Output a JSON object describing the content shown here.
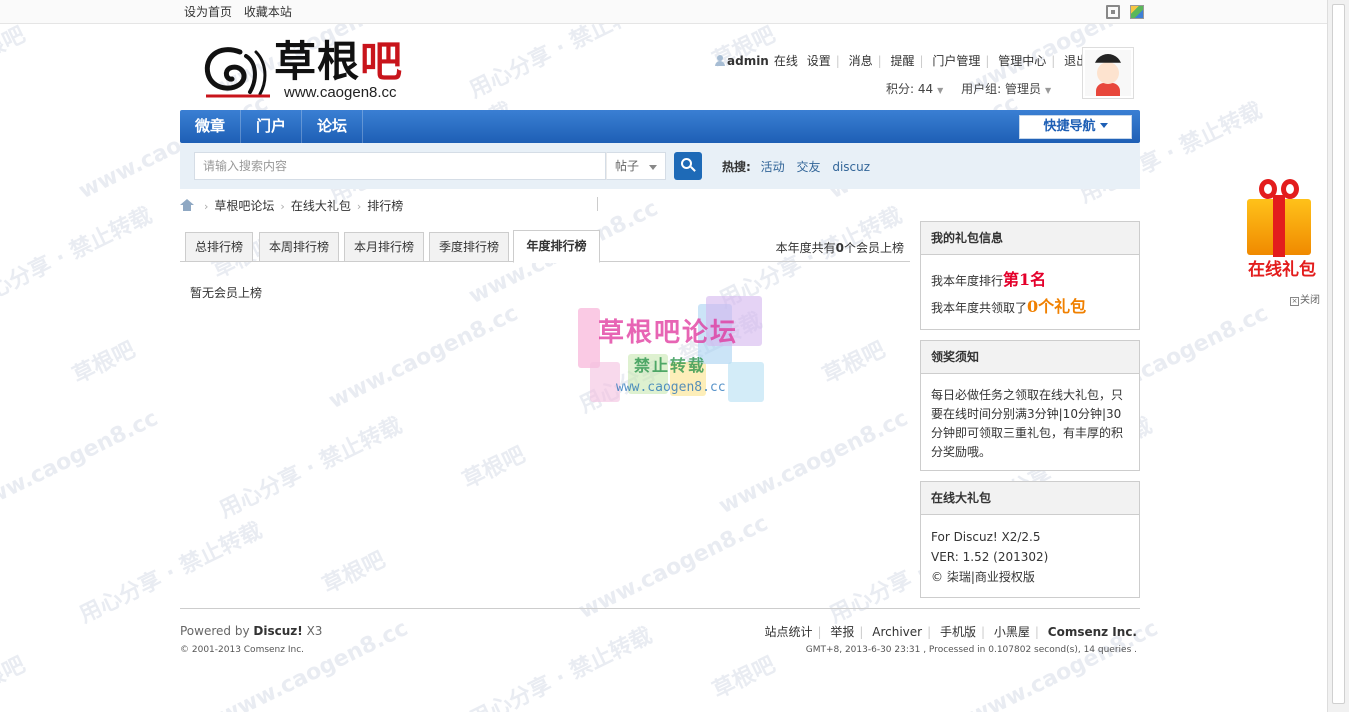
{
  "topbar": {
    "links": [
      "设为首页",
      "收藏本站"
    ]
  },
  "logo": {
    "title_black": "草根",
    "title_red": "吧",
    "url": "www.caogen8.cc"
  },
  "user": {
    "name": "admin",
    "status": "在线",
    "links": [
      "设置",
      "消息",
      "提醒",
      "门户管理",
      "管理中心",
      "退出"
    ],
    "points": "积分: 44",
    "group": "用户组: 管理员"
  },
  "nav": {
    "items": [
      "微章",
      "门户",
      "论坛"
    ],
    "quick_label": "快捷导航"
  },
  "search": {
    "placeholder": "请输入搜索内容",
    "type": "帖子",
    "hot_label": "热搜:",
    "hot_keywords": [
      "活动",
      "交友",
      "discuz"
    ]
  },
  "breadcrumb": [
    "草根吧论坛",
    "在线大礼包",
    "排行榜"
  ],
  "tabs": {
    "items": [
      "总排行榜",
      "本周排行榜",
      "本月排行榜",
      "季度排行榜",
      "年度排行榜"
    ],
    "active_index": 4,
    "count_prefix": "本年度共有",
    "count_value": "0",
    "count_suffix": "个会员上榜"
  },
  "empty_text": "暂无会员上榜",
  "sidebar": {
    "my_gift": {
      "title": "我的礼包信息",
      "rank_prefix": "我本年度排行",
      "rank_value": "第1名",
      "count_prefix": "我本年度共领取了",
      "count_value": "0个礼包"
    },
    "notice": {
      "title": "领奖须知",
      "body": "每日必做任务之领取在线大礼包，只要在线时间分别满3分钟|10分钟|30分钟即可领取三重礼包，有丰厚的积分奖励哦。"
    },
    "plugin": {
      "title": "在线大礼包",
      "lines": [
        "For Discuz! X2/2.5",
        "VER: 1.52 (201302)",
        "© 柒瑞|商业授权版"
      ]
    }
  },
  "footer": {
    "powered_prefix": "Powered by",
    "powered_brand": "Discuz!",
    "powered_version": "X3",
    "copyright": "© 2001-2013 Comsenz Inc.",
    "links": [
      "站点统计",
      "举报",
      "Archiver",
      "手机版",
      "小黑屋",
      "Comsenz Inc."
    ],
    "gmt": "GMT+8, 2013-6-30 23:31 , Processed in 0.107802 second(s), 14 queries ."
  },
  "gift_float": {
    "label": "在线礼包",
    "close": "关闭"
  },
  "watermark": {
    "title": "草根吧论坛",
    "subtitle": "禁止转载",
    "url": "www.caogen8.cc",
    "tile_a": "草根吧",
    "tile_b": "www.caogen8.cc",
    "tile_c": "用心分享 · 禁止转载"
  },
  "colors": {
    "nav_blue": "#1e5fb5",
    "rank_red": "#e4002b",
    "gift_orange": "#f08000"
  }
}
